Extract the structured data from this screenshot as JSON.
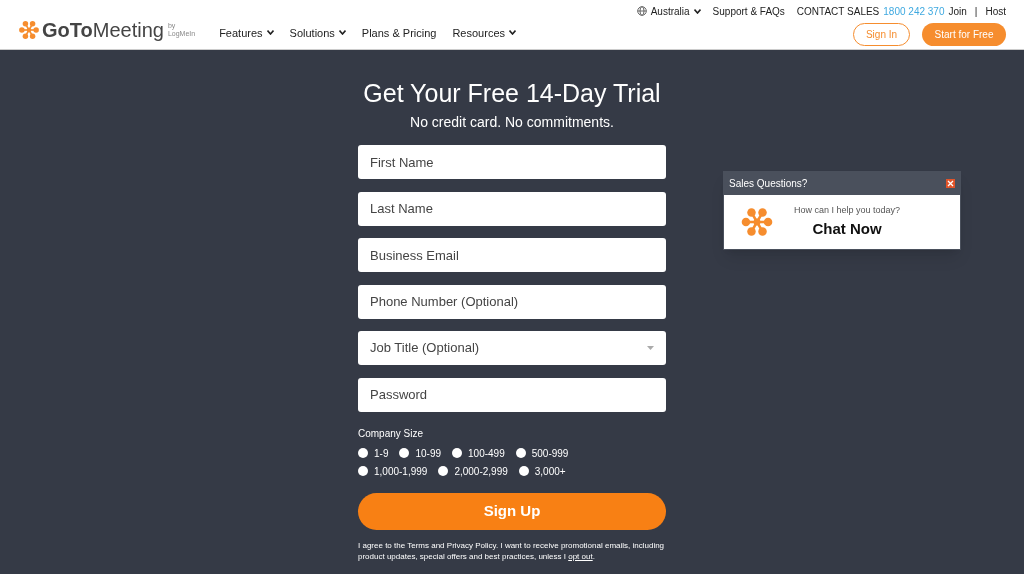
{
  "header": {
    "logo": {
      "brand_bold": "GoTo",
      "brand_light": "Meeting",
      "by": "by",
      "maker": "LogMeIn"
    },
    "nav": [
      {
        "label": "Features",
        "dropdown": true
      },
      {
        "label": "Solutions",
        "dropdown": true
      },
      {
        "label": "Plans & Pricing",
        "dropdown": false
      },
      {
        "label": "Resources",
        "dropdown": true
      }
    ],
    "top_links": {
      "region": "Australia",
      "support": "Support & FAQs",
      "contact": "CONTACT SALES",
      "phone": "1800 242 370",
      "join": "Join",
      "separator": "|",
      "host": "Host"
    },
    "sign_in": "Sign In",
    "start": "Start for Free"
  },
  "form": {
    "title": "Get Your Free 14-Day Trial",
    "subtitle": "No credit card. No commitments.",
    "fields": [
      {
        "kind": "text",
        "placeholder": "First Name"
      },
      {
        "kind": "text",
        "placeholder": "Last Name"
      },
      {
        "kind": "text",
        "placeholder": "Business Email"
      },
      {
        "kind": "text",
        "placeholder": "Phone Number (Optional)"
      },
      {
        "kind": "select",
        "placeholder": "Job Title (Optional)"
      },
      {
        "kind": "password",
        "placeholder": "Password"
      }
    ],
    "company_size": {
      "label": "Company Size",
      "options": [
        {
          "label": "1-9",
          "selected": false
        },
        {
          "label": "10-99",
          "selected": false
        },
        {
          "label": "100-499",
          "selected": false
        },
        {
          "label": "500-999",
          "selected": false
        },
        {
          "label": "1,000-1,999",
          "selected": false
        },
        {
          "label": "2,000-2,999",
          "selected": false
        },
        {
          "label": "3,000+",
          "selected": false
        }
      ]
    },
    "submit": "Sign Up",
    "consent": {
      "text": "I agree to the Terms and Privacy Policy. I want to receive promotional emails, including product updates, special offers and best practices, unless I",
      "link": "opt out",
      "end": "."
    }
  },
  "chat": {
    "title": "Sales Questions?",
    "prompt": "How can I help you today?",
    "action": "Chat Now"
  }
}
